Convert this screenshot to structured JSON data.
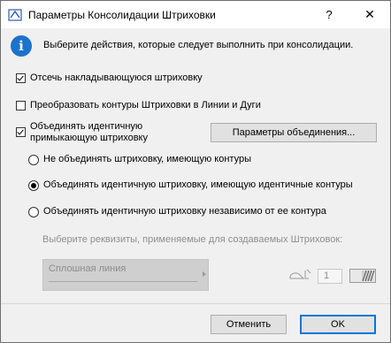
{
  "window": {
    "title": "Параметры Консолидации Штриховки",
    "help_glyph": "?",
    "close_glyph": "✕"
  },
  "info": {
    "icon_glyph": "i",
    "text": "Выберите действия, которые следует выполнить при консолидации."
  },
  "options": {
    "cut_overlapping": {
      "label": "Отсечь накладывающуюся штриховку",
      "checked": true
    },
    "convert_contours": {
      "label": "Преобразовать контуры Штриховки в Линии и Дуги",
      "checked": false
    },
    "merge_adjacent": {
      "label_line1": "Объединять идентичную",
      "label_line2": "примыкающую штриховку",
      "checked": true
    }
  },
  "merge_params_button": "Параметры объединения...",
  "merge_modes": {
    "selected": "identical_contours",
    "items": [
      {
        "id": "no_contours",
        "label": "Не объединять штриховку, имеющую контуры"
      },
      {
        "id": "identical_contours",
        "label": "Объединять идентичную штриховку, имеющую идентичные контуры"
      },
      {
        "id": "regardless_contour",
        "label": "Объединять идентичную штриховку независимо от ее контура"
      }
    ]
  },
  "attributes": {
    "prompt": "Выберите реквизиты, применяемые для создаваемых Штриховок:",
    "line_type": "Сплошная линия",
    "pen_number": "1"
  },
  "footer": {
    "cancel_label": "Отменить",
    "ok_label": "OK"
  },
  "colors": {
    "accent": "#0078d7",
    "info_icon": "#1a73cc"
  }
}
